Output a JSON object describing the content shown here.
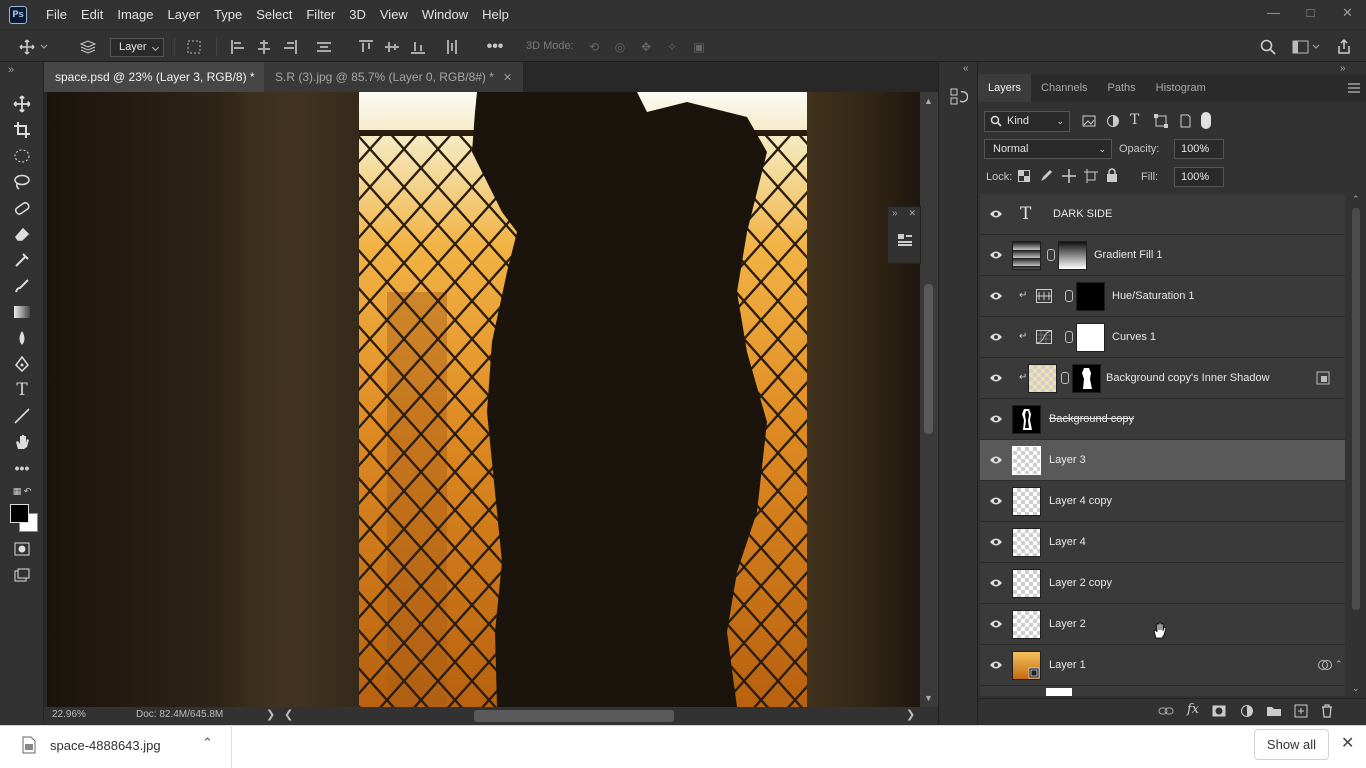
{
  "app": {
    "logo": "Ps"
  },
  "menu": [
    "File",
    "Edit",
    "Image",
    "Layer",
    "Type",
    "Select",
    "Filter",
    "3D",
    "View",
    "Window",
    "Help"
  ],
  "options_bar": {
    "auto_select_target": "Layer",
    "mode_3d_label": "3D Mode:"
  },
  "tabs": [
    {
      "label": "space.psd @ 23% (Layer 3, RGB/8) *",
      "active": true
    },
    {
      "label": "S.R (3).jpg @ 85.7% (Layer 0, RGB/8#) *",
      "active": false
    }
  ],
  "status": {
    "zoom": "22.96%",
    "doc": "Doc: 82.4M/645.8M"
  },
  "layers_panel": {
    "tabs": [
      "Layers",
      "Channels",
      "Paths",
      "Histogram"
    ],
    "filter": "Kind",
    "blend_mode": "Normal",
    "opacity_label": "Opacity:",
    "opacity": "100%",
    "lock_label": "Lock:",
    "fill_label": "Fill:",
    "fill": "100%",
    "layers": [
      {
        "name": "DARK SIDE",
        "kind": "type",
        "selected": false
      },
      {
        "name": "Gradient Fill 1",
        "kind": "gradient",
        "selected": false
      },
      {
        "name": "Hue/Saturation 1",
        "kind": "adjust-hue",
        "clipped": true,
        "selected": false
      },
      {
        "name": "Curves 1",
        "kind": "adjust-curves",
        "clipped": true,
        "selected": false
      },
      {
        "name": "Background copy's Inner Shadow",
        "kind": "effect",
        "clipped": true,
        "selected": false
      },
      {
        "name": "Background copy",
        "kind": "pixel",
        "strikethrough": true,
        "selected": false
      },
      {
        "name": "Layer 3",
        "kind": "pixel",
        "selected": true
      },
      {
        "name": "Layer 4 copy",
        "kind": "pixel",
        "selected": false
      },
      {
        "name": "Layer 4",
        "kind": "pixel",
        "selected": false
      },
      {
        "name": "Layer 2 copy",
        "kind": "pixel",
        "selected": false
      },
      {
        "name": "Layer 2",
        "kind": "pixel",
        "selected": false
      },
      {
        "name": "Layer 1",
        "kind": "smart",
        "selected": false
      }
    ]
  },
  "download_bar": {
    "file": "space-4888643.jpg",
    "show_all": "Show all"
  },
  "colors": {
    "ui_dark": "#323232",
    "ui_panel": "#3a3a3a",
    "selected_layer": "#595959",
    "accent_orange": "#d9861f"
  }
}
